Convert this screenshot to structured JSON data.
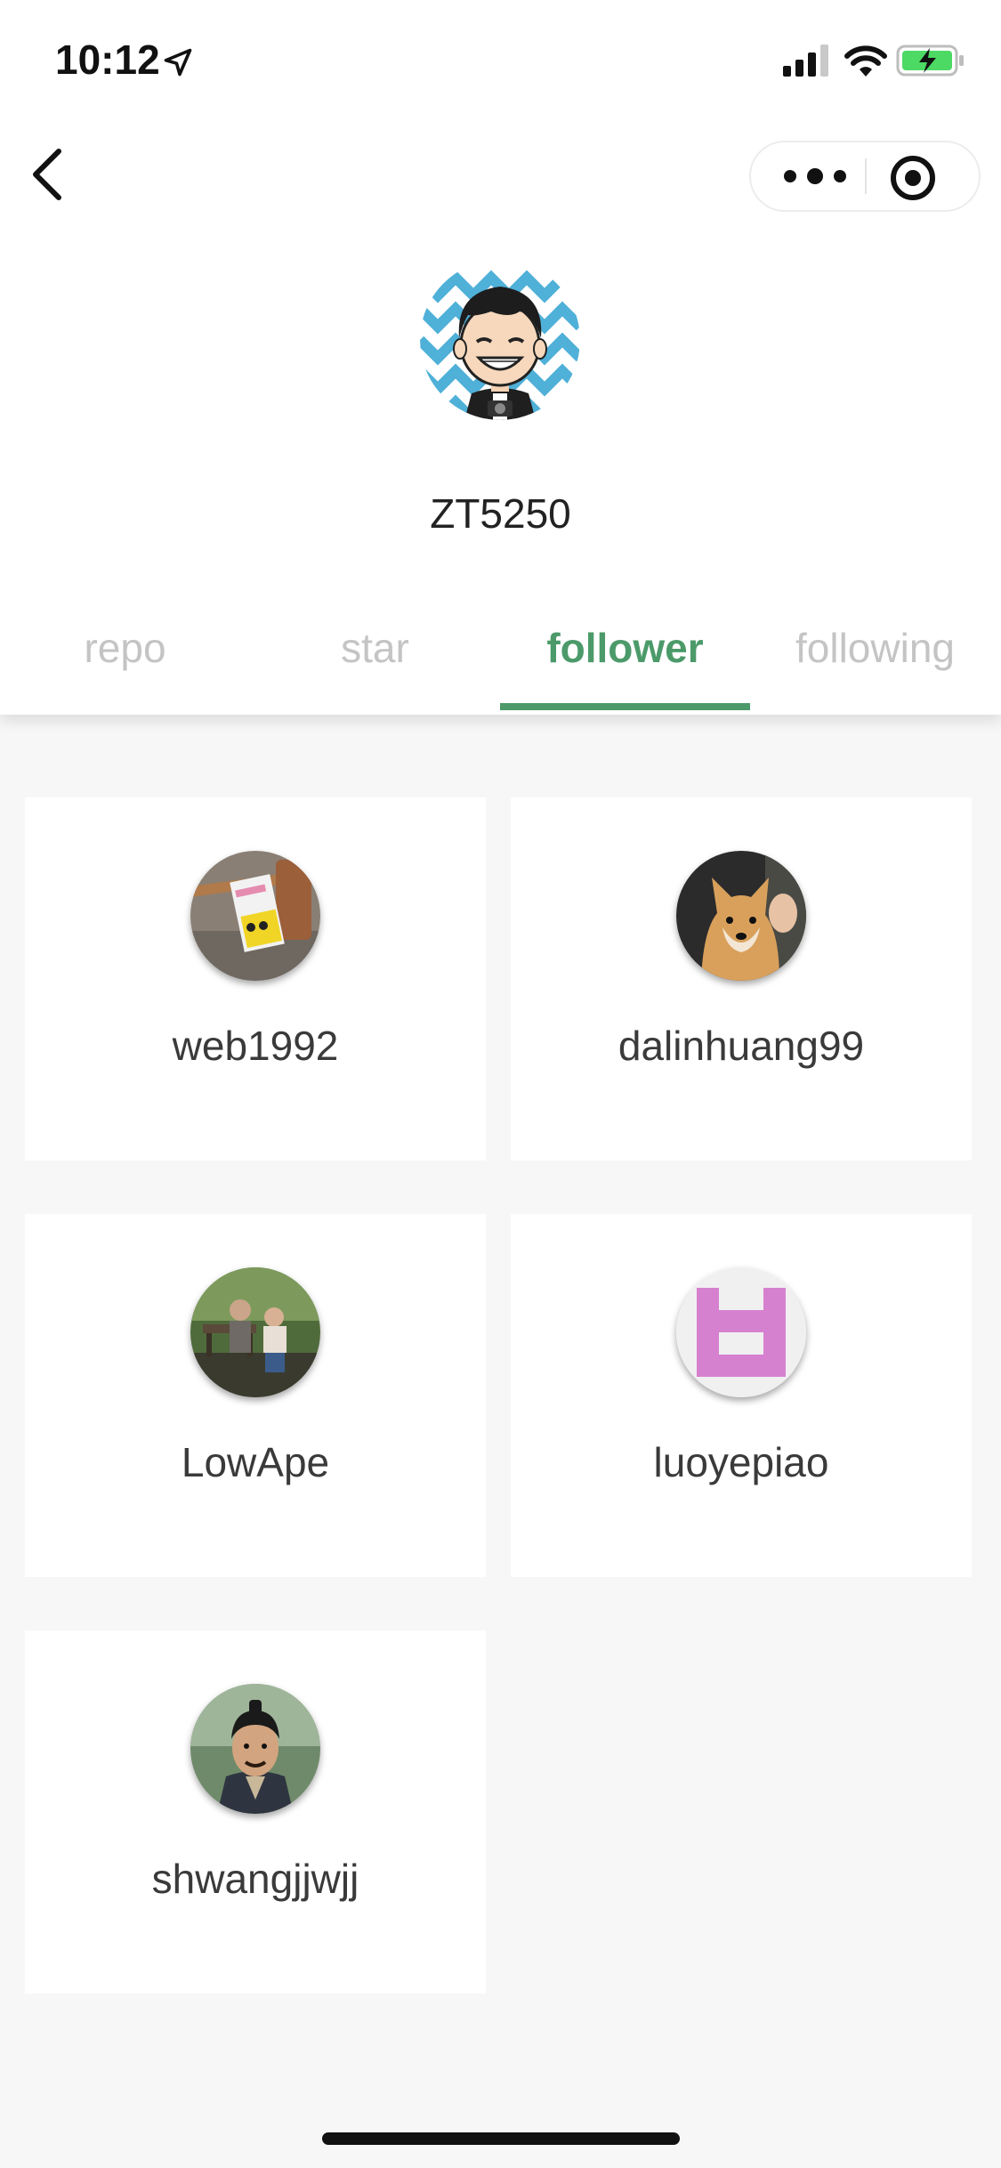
{
  "status_bar": {
    "time": "10:12",
    "icons": [
      "location-arrow-icon",
      "cellular-signal-icon",
      "wifi-icon",
      "battery-charging-icon"
    ],
    "battery_color": "#4cd964"
  },
  "nav": {
    "back_icon": "chevron-left-icon",
    "more_icon": "more-dots-icon",
    "close_icon": "target-circle-icon"
  },
  "profile": {
    "username": "ZT5250"
  },
  "tabs": [
    {
      "label": "repo",
      "active": false
    },
    {
      "label": "star",
      "active": false
    },
    {
      "label": "follower",
      "active": true
    },
    {
      "label": "following",
      "active": false
    }
  ],
  "accent_color": "#4c9a6a",
  "followers": [
    {
      "name": "web1992"
    },
    {
      "name": "dalinhuang99"
    },
    {
      "name": "LowApe"
    },
    {
      "name": "luoyepiao"
    },
    {
      "name": "shwangjjwjj"
    }
  ]
}
